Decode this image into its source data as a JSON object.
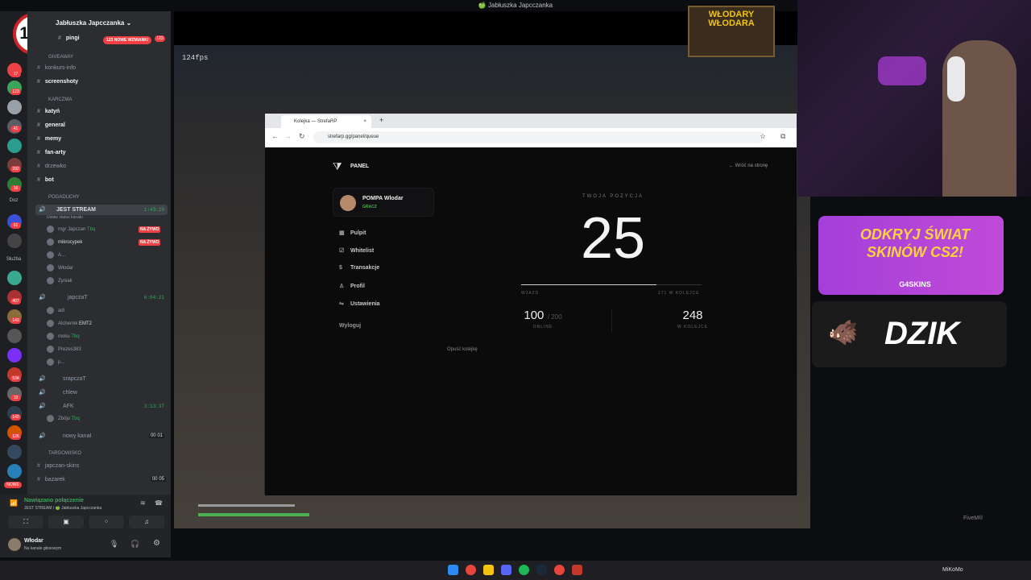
{
  "window_title": "🍏 Jabłuszka Japcczanka",
  "age_badge": "18+",
  "rail": {
    "labels": [
      "Doz",
      "Służba"
    ],
    "badges": [
      "17",
      "123",
      "41",
      "292",
      "16",
      "61",
      "29",
      "407",
      "143",
      "1",
      "534",
      "19",
      "142",
      "126",
      "1",
      "NOWE"
    ]
  },
  "server": {
    "name": "Jabłuszka Japcczanka",
    "mentions_pill": "123 NOWE WZMIANKI",
    "top_channel": "pingi",
    "top_channel_badge": "123",
    "categories": [
      "GIVEAWAY",
      "KARCZMA",
      "POGADUCHY",
      "TARGOWISKO"
    ],
    "giveaway_channels": [
      "konkurs-info",
      "screenshoty"
    ],
    "karczma_channels": [
      "katyń",
      "general",
      "memy",
      "fan-arty",
      "drzewko",
      "bot"
    ],
    "voice": {
      "active_channel": "JEST STREAM",
      "active_time": "1:43:29",
      "status_hint": "Ustaw status kanału",
      "live_label": "NA ŻYWO",
      "stream_users": [
        "mgr Japczan",
        "mikrocypek",
        "A...",
        "Włodar",
        "Zyniak"
      ],
      "stream_tag": "Tbq",
      "second_channel": "japczaT",
      "second_time": "6:04:21",
      "second_users": [
        "adi",
        "Alchemik",
        "moku",
        "Prezes383",
        "p..."
      ],
      "second_tags": [
        "EMT2",
        "Tbq"
      ],
      "other_channels": [
        "srapczaT",
        "chlew",
        "AFK"
      ],
      "afk_time": "3:13:37",
      "afk_user": "Zbóju",
      "new_channel": "nowy kanał",
      "new_channel_counts": [
        "00",
        "01"
      ]
    },
    "targowisko_channels": [
      "japczan-skins",
      "bazarek"
    ],
    "bazarek_counts": [
      "00",
      "05"
    ]
  },
  "voice_panel": {
    "status": "Nawiązano połączenie",
    "location": "JEST STREAM / 🍏 Jabłuszka Japcczanka"
  },
  "user_panel": {
    "username": "Włodar",
    "status": "Na kanale głosowym"
  },
  "game": {
    "fps": "124fps",
    "sign_text": "WŁODARY WŁODARA"
  },
  "browser": {
    "tab_title": "Kolejka — StrefaRP",
    "url": "strefarp.gg/panel/queue",
    "brand": "PANEL",
    "back_link": "← Wróć na stronę",
    "profile_name": "POMPA Wlodar",
    "profile_role": "GRACZ",
    "nav": [
      "Pulpit",
      "Whitelist",
      "Transakcje",
      "Profil",
      "Ustawienia"
    ],
    "logout": "Wyloguj",
    "position_label": "TWOJA POZYCJA",
    "position": "25",
    "progress_left": "WJAZD",
    "progress_right": "171 W KOLEJCE",
    "progress_fraction": 0.75,
    "online_value": "100",
    "online_max": "/ 200",
    "online_label": "ONLINE",
    "queue_value": "248",
    "queue_label": "W KOLEJCE",
    "leave_queue": "Opuść kolejkę"
  },
  "ads": {
    "cs2_title": "ODKRYJ ŚWIAT SKINÓW CS2!",
    "cs2_brand": "G4SKINS",
    "dzik": "DZIK"
  },
  "fivem": "FiveM®",
  "taskbar": {
    "user": "MiKoMo"
  },
  "colors": {
    "discord_green": "#3ba55c",
    "discord_red": "#ed4245",
    "panel_green": "#4caf50",
    "ad_purple": "#b044d8"
  }
}
